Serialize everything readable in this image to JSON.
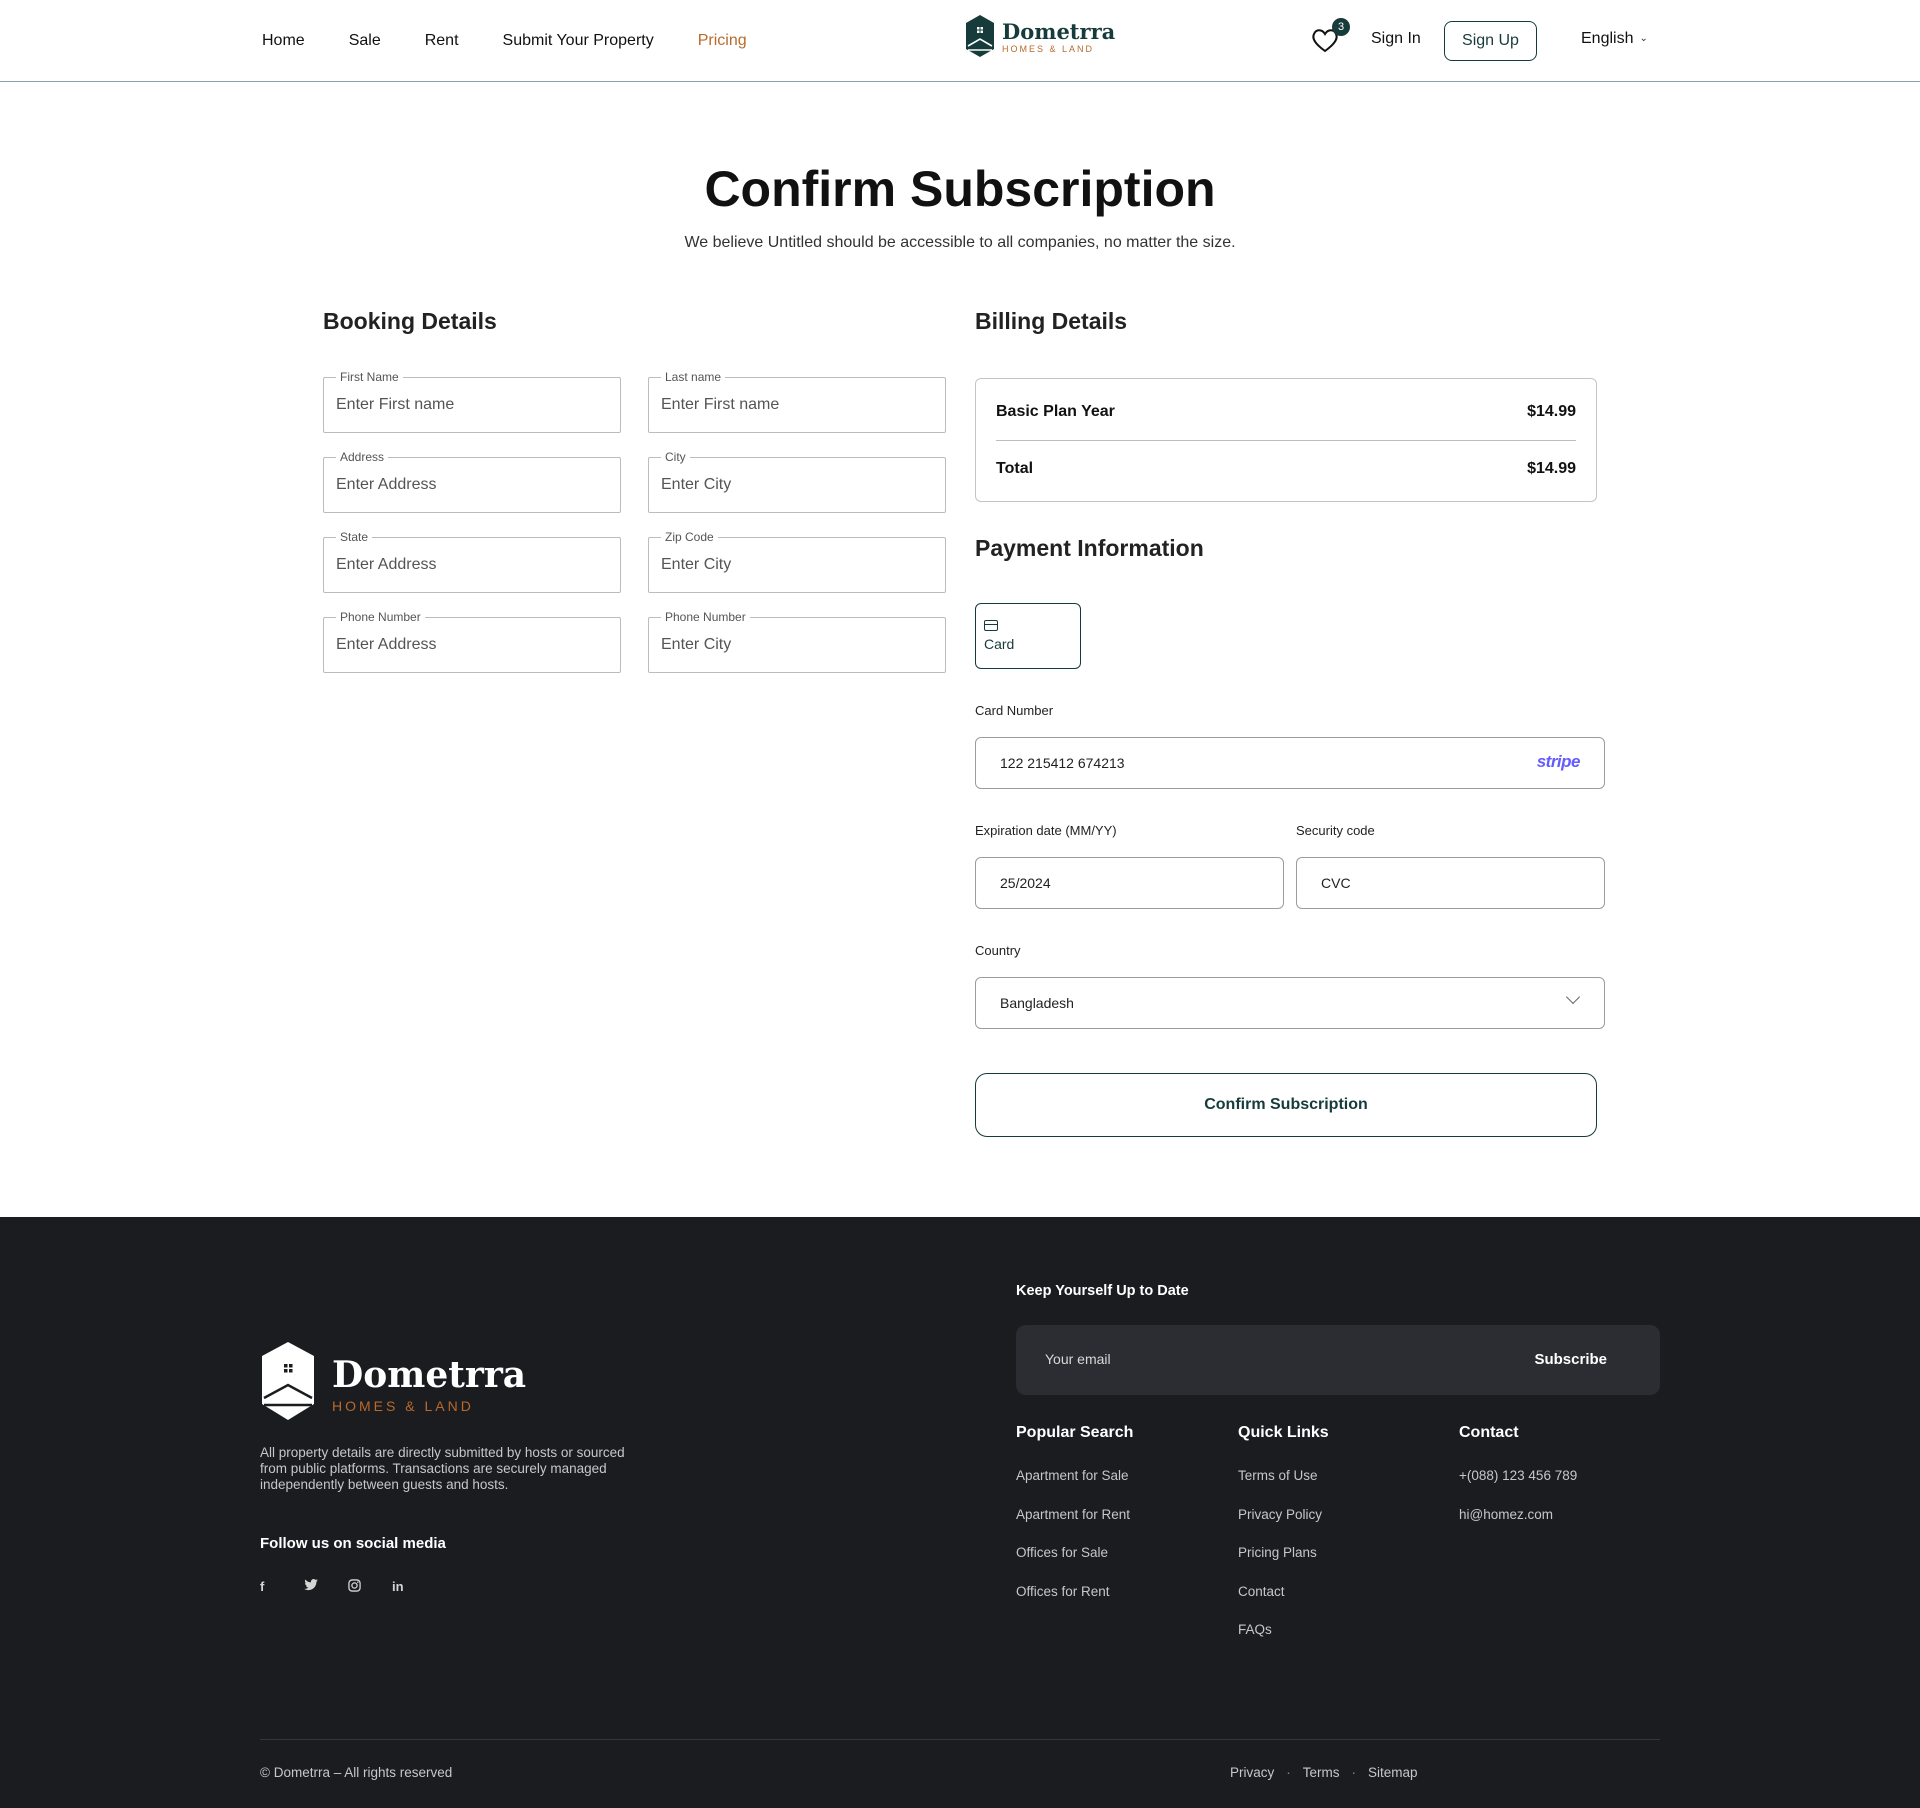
{
  "header": {
    "nav": [
      "Home",
      "Sale",
      "Rent",
      "Submit Your Property",
      "Pricing"
    ],
    "active_nav": "Pricing",
    "logo_name": "Dometrra",
    "logo_tag": "HOMES & LAND",
    "wishlist_count": "3",
    "sign_in": "Sign In",
    "sign_up": "Sign Up",
    "language": "English"
  },
  "page": {
    "title": "Confirm Subscription",
    "subtitle": "We believe Untitled should be accessible to all companies, no matter the size."
  },
  "booking": {
    "title": "Booking Details",
    "fields": [
      {
        "label": "First Name",
        "placeholder": "Enter First name"
      },
      {
        "label": "Last name",
        "placeholder": "Enter First name"
      },
      {
        "label": "Address",
        "placeholder": "Enter Address"
      },
      {
        "label": "City",
        "placeholder": "Enter City"
      },
      {
        "label": "State",
        "placeholder": "Enter Address"
      },
      {
        "label": "Zip Code",
        "placeholder": "Enter City"
      },
      {
        "label": "Phone Number",
        "placeholder": "Enter Address"
      },
      {
        "label": "Phone Number",
        "placeholder": "Enter City"
      }
    ]
  },
  "billing": {
    "title": "Billing Details",
    "plan_label": "Basic Plan Year",
    "plan_price": "$14.99",
    "total_label": "Total",
    "total_price": "$14.99"
  },
  "payment": {
    "title": "Payment Information",
    "method": "Card",
    "card_number_label": "Card Number",
    "card_number": "122 215412 674213",
    "provider": "stripe",
    "expiry_label": "Expiration date (MM/YY)",
    "expiry": "25/2024",
    "cvc_label": "Security code",
    "cvc": "CVC",
    "country_label": "Country",
    "country": "Bangladesh",
    "confirm": "Confirm Subscription"
  },
  "footer": {
    "logo_name": "Dometrra",
    "logo_tag": "HOMES & LAND",
    "description": "All property details are directly submitted by hosts or sourced from public platforms. Transactions are securely managed independently between guests and hosts.",
    "follow": "Follow us on social media",
    "social": [
      "f",
      "t",
      "ig",
      "in"
    ],
    "keep_up": "Keep Yourself Up to Date",
    "email_placeholder": "Your email",
    "subscribe": "Subscribe",
    "popular_title": "Popular Search",
    "popular": [
      "Apartment for Sale",
      "Apartment for Rent",
      "Offices for Sale",
      "Offices for Rent"
    ],
    "quick_title": "Quick Links",
    "quick": [
      "Terms of Use",
      "Privacy Policy",
      "Pricing Plans",
      "Contact",
      "FAQs"
    ],
    "contact_title": "Contact",
    "contact": [
      "+(088) 123 456 789",
      "hi@homez.com"
    ],
    "copyright": "© Dometrra – All rights reserved",
    "bottom_links": [
      "Privacy",
      "Terms",
      "Sitemap"
    ]
  },
  "colors": {
    "brand": "#173b3b",
    "accent": "#b86a2b",
    "footer_bg": "#1b1c20",
    "stripe": "#635bff"
  }
}
